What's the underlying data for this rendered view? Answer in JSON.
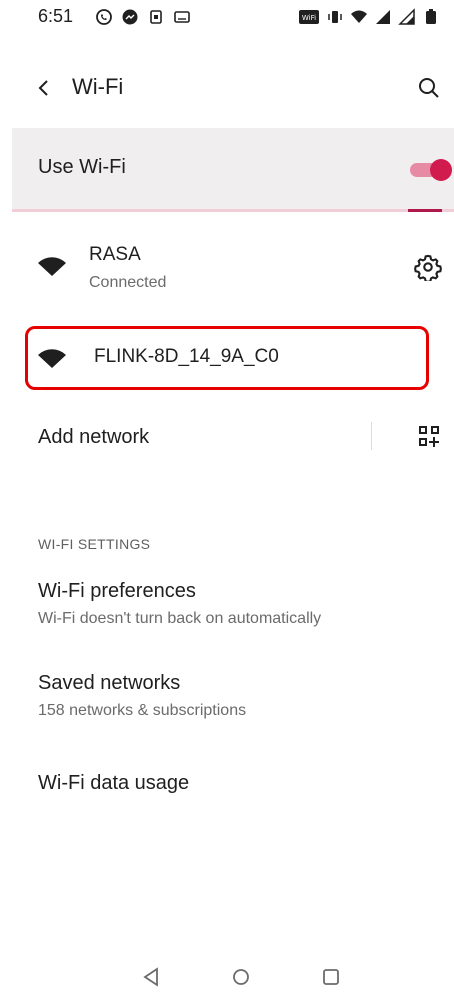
{
  "status_bar": {
    "time": "6:51",
    "left_icons": [
      "whatsapp-icon",
      "messenger-icon",
      "notification-icon",
      "keyboard-icon"
    ],
    "right_icons": [
      "volte-wifi-icon",
      "vibrate-icon",
      "wifi-icon",
      "signal-icon",
      "signal-icon",
      "battery-icon"
    ]
  },
  "app_bar": {
    "title": "Wi-Fi"
  },
  "use_wifi": {
    "label": "Use Wi-Fi",
    "enabled": true
  },
  "networks": [
    {
      "name": "RASA",
      "status": "Connected",
      "has_settings": true
    },
    {
      "name": "FLINK-8D_14_9A_C0",
      "status": "",
      "highlighted": true
    }
  ],
  "add_network": {
    "label": "Add network"
  },
  "settings_section": {
    "header": "WI-FI SETTINGS",
    "items": [
      {
        "title": "Wi-Fi preferences",
        "subtitle": "Wi-Fi doesn't turn back on automatically"
      },
      {
        "title": "Saved networks",
        "subtitle": "158 networks & subscriptions"
      },
      {
        "title": "Wi-Fi data usage",
        "subtitle": ""
      }
    ]
  },
  "colors": {
    "accent": "#d11a4e",
    "toggle_track": "#e78aa3",
    "highlight_border": "#e60000",
    "use_wifi_bg": "#f1eef0"
  }
}
